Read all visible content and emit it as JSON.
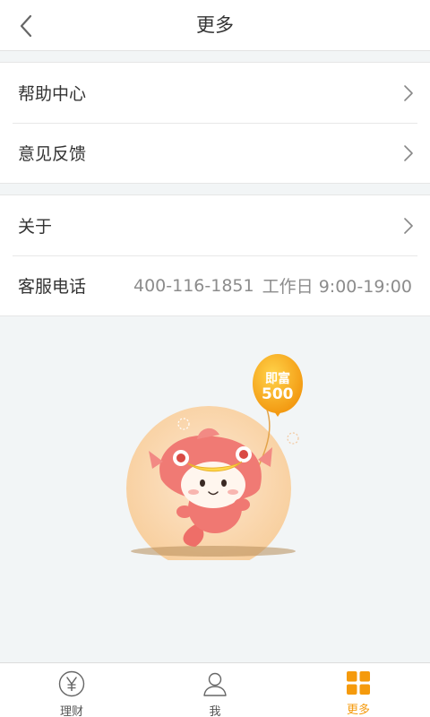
{
  "header": {
    "title": "更多",
    "back_icon": "chevron-left-icon"
  },
  "group1": {
    "items": [
      {
        "label": "帮助中心"
      },
      {
        "label": "意见反馈"
      }
    ]
  },
  "group2": {
    "about": {
      "label": "关于"
    },
    "service": {
      "label": "客服电话",
      "phone": "400-116-1851",
      "hours": "工作日 9:00-19:00"
    }
  },
  "mascot": {
    "balloon_text": [
      "即富",
      "500"
    ]
  },
  "tabbar": {
    "active_color": "#f59a0c",
    "tabs": [
      {
        "label": "理财",
        "icon": "yen-circle-icon"
      },
      {
        "label": "我",
        "icon": "user-icon"
      },
      {
        "label": "更多",
        "icon": "grid-icon",
        "active": true
      }
    ]
  }
}
